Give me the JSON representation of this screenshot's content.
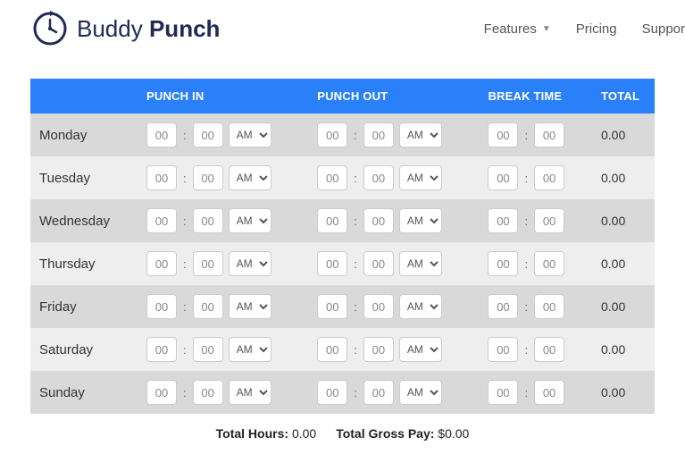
{
  "brand": {
    "name1": "Buddy",
    "name2": "Punch"
  },
  "nav": {
    "features": "Features",
    "pricing": "Pricing",
    "support": "Suppor"
  },
  "headers": {
    "day": "",
    "punch_in": "PUNCH IN",
    "punch_out": "PUNCH OUT",
    "break_time": "BREAK TIME",
    "total": "TOTAL"
  },
  "default_vals": {
    "hh": "00",
    "mm": "00",
    "ampm": "AM"
  },
  "rows": [
    {
      "day": "Monday",
      "in_h": "00",
      "in_m": "00",
      "in_ap": "AM",
      "out_h": "00",
      "out_m": "00",
      "out_ap": "AM",
      "br_h": "00",
      "br_m": "00",
      "total": "0.00"
    },
    {
      "day": "Tuesday",
      "in_h": "00",
      "in_m": "00",
      "in_ap": "AM",
      "out_h": "00",
      "out_m": "00",
      "out_ap": "AM",
      "br_h": "00",
      "br_m": "00",
      "total": "0.00"
    },
    {
      "day": "Wednesday",
      "in_h": "00",
      "in_m": "00",
      "in_ap": "AM",
      "out_h": "00",
      "out_m": "00",
      "out_ap": "AM",
      "br_h": "00",
      "br_m": "00",
      "total": "0.00"
    },
    {
      "day": "Thursday",
      "in_h": "00",
      "in_m": "00",
      "in_ap": "AM",
      "out_h": "00",
      "out_m": "00",
      "out_ap": "AM",
      "br_h": "00",
      "br_m": "00",
      "total": "0.00"
    },
    {
      "day": "Friday",
      "in_h": "00",
      "in_m": "00",
      "in_ap": "AM",
      "out_h": "00",
      "out_m": "00",
      "out_ap": "AM",
      "br_h": "00",
      "br_m": "00",
      "total": "0.00"
    },
    {
      "day": "Saturday",
      "in_h": "00",
      "in_m": "00",
      "in_ap": "AM",
      "out_h": "00",
      "out_m": "00",
      "out_ap": "AM",
      "br_h": "00",
      "br_m": "00",
      "total": "0.00"
    },
    {
      "day": "Sunday",
      "in_h": "00",
      "in_m": "00",
      "in_ap": "AM",
      "out_h": "00",
      "out_m": "00",
      "out_ap": "AM",
      "br_h": "00",
      "br_m": "00",
      "total": "0.00"
    }
  ],
  "footer": {
    "total_hours_label": "Total Hours:",
    "total_hours_value": "0.00",
    "total_pay_label": "Total Gross Pay:",
    "total_pay_value": "$0.00"
  }
}
